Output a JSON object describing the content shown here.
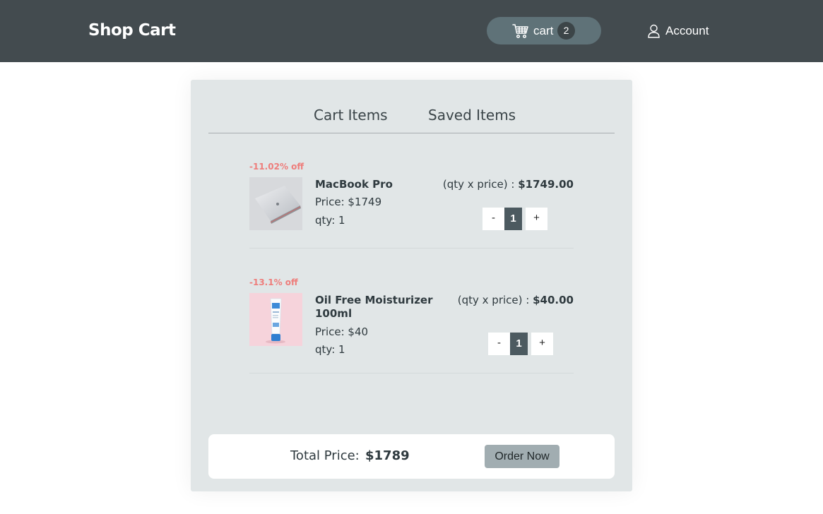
{
  "header": {
    "brand": "Shop Cart",
    "cart_label": "cart",
    "cart_count": "2",
    "account_label": "Account",
    "bg_color": "#434b4f",
    "cart_pill_color": "#5f7278"
  },
  "tabs": [
    {
      "label": "Cart Items"
    },
    {
      "label": "Saved Items"
    }
  ],
  "items": [
    {
      "discount": "-11.02% off",
      "name": "MacBook Pro",
      "price": "Price: $1749",
      "qty": "qty: 1",
      "line_total_label": "(qty x price) :",
      "line_total_value": "$1749.00",
      "quantity": "1",
      "minus": "-",
      "plus": "+",
      "image_icon": "laptop-image"
    },
    {
      "discount": "-13.1% off",
      "name": "Oil Free Moisturizer 100ml",
      "price": "Price: $40",
      "qty": "qty: 1",
      "line_total_label": "(qty x price) :",
      "line_total_value": "$40.00",
      "quantity": "1",
      "minus": "-",
      "plus": "+",
      "image_icon": "moisturizer-tube-image"
    }
  ],
  "footer": {
    "total_label": "Total Price:",
    "total_value": "$1789",
    "order_button": "Order Now"
  },
  "colors": {
    "discount": "#ee7d7b",
    "card_bg": "#e1e6e7",
    "stepper_value_bg": "#4c5a60",
    "order_button_bg": "#a1adb1"
  }
}
